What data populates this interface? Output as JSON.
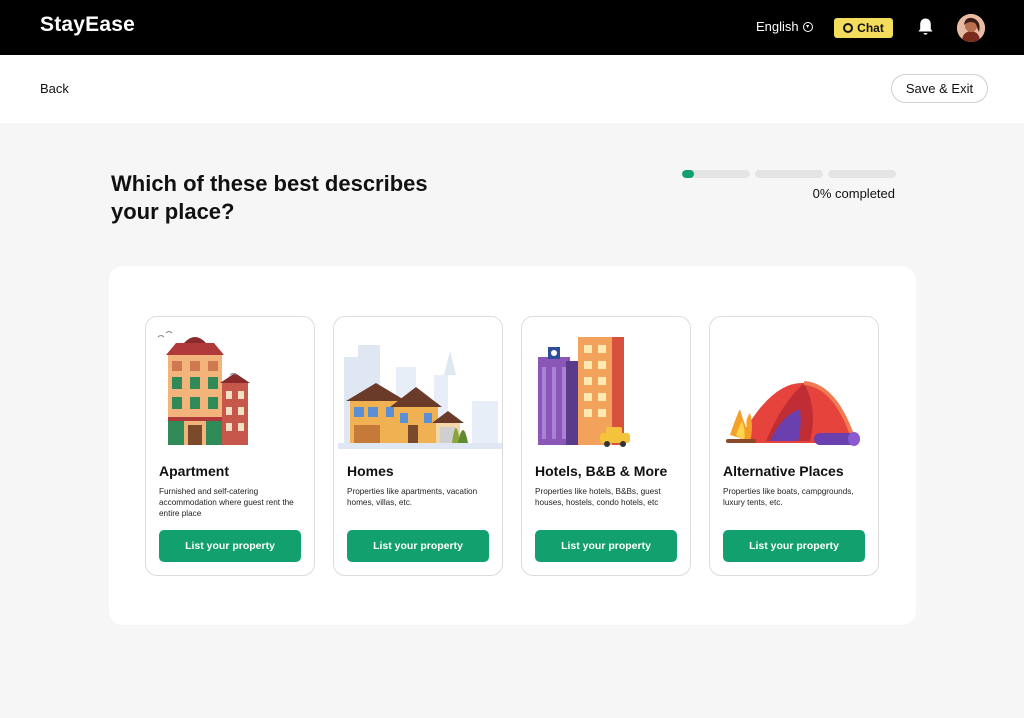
{
  "header": {
    "logo": "StayEase",
    "language": "English",
    "chat_label": "Chat"
  },
  "subbar": {
    "back_label": "Back",
    "save_exit_label": "Save & Exit"
  },
  "main": {
    "title": "Which of these best describes your place?",
    "progress": {
      "percent": 0,
      "label": "0% completed",
      "segments": 3
    }
  },
  "cards": [
    {
      "title": "Apartment",
      "description": "Furnished and self-catering accommodation where guest rent the entire place",
      "button": "List your property",
      "illustration": "apartment-building-icon"
    },
    {
      "title": "Homes",
      "description": "Properties like apartments, vacation homes, villas, etc.",
      "button": "List your property",
      "illustration": "house-icon"
    },
    {
      "title": "Hotels, B&B & More",
      "description": "Properties like hotels, B&Bs, guest houses, hostels, condo hotels, etc",
      "button": "List your property",
      "illustration": "hotel-buildings-icon"
    },
    {
      "title": "Alternative Places",
      "description": "Properties like boats, campgrounds, luxury tents, etc.",
      "button": "List your property",
      "illustration": "tent-campfire-icon"
    }
  ],
  "colors": {
    "primary": "#12a06e",
    "chat": "#f4dc5c",
    "header_bg": "#000000",
    "page_bg": "#f6f6f6"
  }
}
